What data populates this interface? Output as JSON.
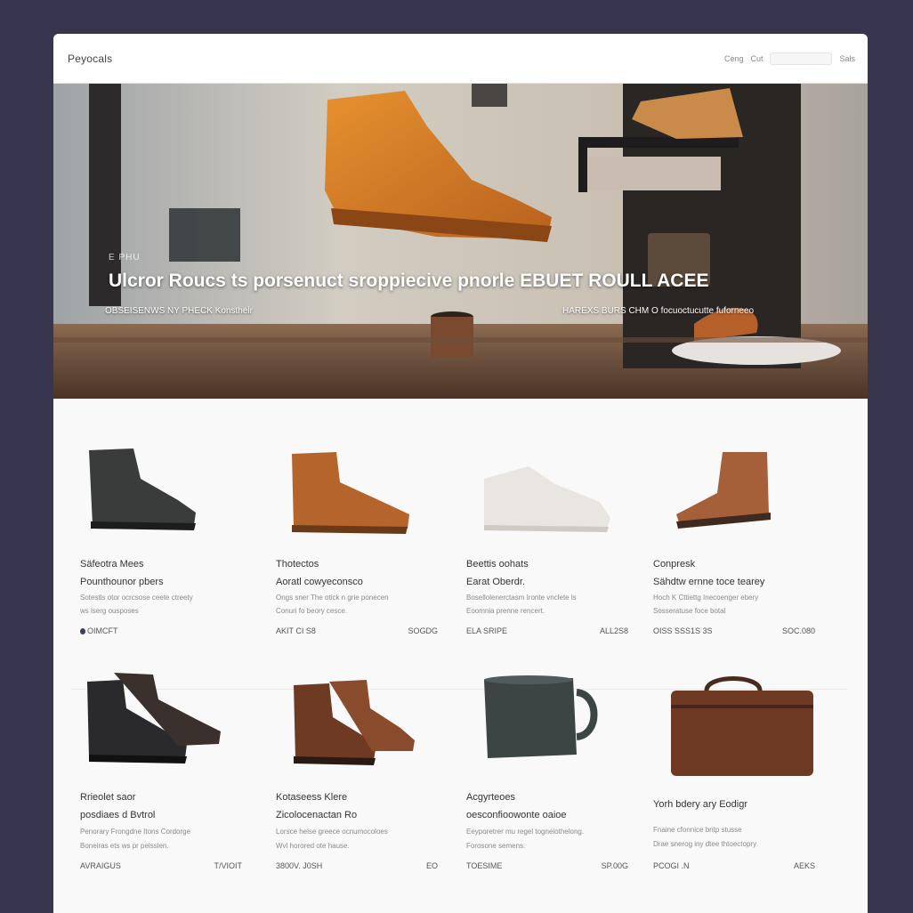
{
  "brand": "Peyocals",
  "nav": {
    "links": [
      "Ceng",
      "Cut"
    ],
    "search_placeholder": "",
    "extra": "Sals"
  },
  "hero": {
    "kicker": "E PHU",
    "title": "Ulcror Roucs ts porsenuct   sroppiecive pnorle   EBUET ROULL ACEE",
    "sub_left": "OBSEISENWS NY PHECK Konsthelr",
    "sub_right": "HAREXS BURS  CHM O focuoctucutte fuforneeo"
  },
  "products": [
    {
      "name": "Säfeotra Mees",
      "sub": "Pounthounor pbers",
      "desc1": "Sotestls otor ocrcsose ceete ctreety",
      "desc2": "ws lserg ousposes",
      "left": "OIMCFT",
      "right": ""
    },
    {
      "name": "Thotectos",
      "sub": "Aoratl cowyeconsco",
      "desc1": "Ongs sner The otick n grie ponecen",
      "desc2": "Conuri fo beory cesce.",
      "left": "AKIT CI S8",
      "right": "SOGDG"
    },
    {
      "name": "Beettis oohats",
      "sub": "Earat Oberdr.",
      "desc1": "Bosellolenerctasm Ironte vnclete ls",
      "desc2": "Eoomnia prenne rencert.",
      "left": "ELA  SRIPE",
      "right": "ALL2S8"
    },
    {
      "name": "Conpresk",
      "sub": "Sähdtw ernne toce tearey",
      "desc1": "Hoch K Cttiettg Inecoenger ebery",
      "desc2": "Sosseratuse foce botal",
      "left": "OISS  SSS1S 3S",
      "right": "SOC.080"
    },
    {
      "name": "Rrieolet saor",
      "sub": "posdiaes d Bvtrol",
      "desc1": "Penorary Frongdne Itons Cordorge",
      "desc2": "Boneiras ets ws pr pelsslen.",
      "left": "AVRAIGUS",
      "right": "T/VIOIT"
    },
    {
      "name": "Kotaseess Klere",
      "sub": "Zicolocenactan Ro",
      "desc1": "Lorsce helse greece ocnumocoloes",
      "desc2": "Wvl horored ote hause.",
      "left": "3800V. J0SH",
      "right": "EO"
    },
    {
      "name": "Acgyrteoes",
      "sub": "oesconfioowonte oaioe",
      "desc1": "Eeyporetrer mu regel togneiothelong.",
      "desc2": "Forosone semens.",
      "left": "TOESIME",
      "right": "SP.00G"
    },
    {
      "name": "Yorh bdery ary Eodigr",
      "sub": "",
      "desc1": "Fnaine cfonnice bntp stusse",
      "desc2": "Drae snerog iny dtee thtoectopry",
      "left": "PCOGI .N",
      "right": "AEKS"
    }
  ]
}
